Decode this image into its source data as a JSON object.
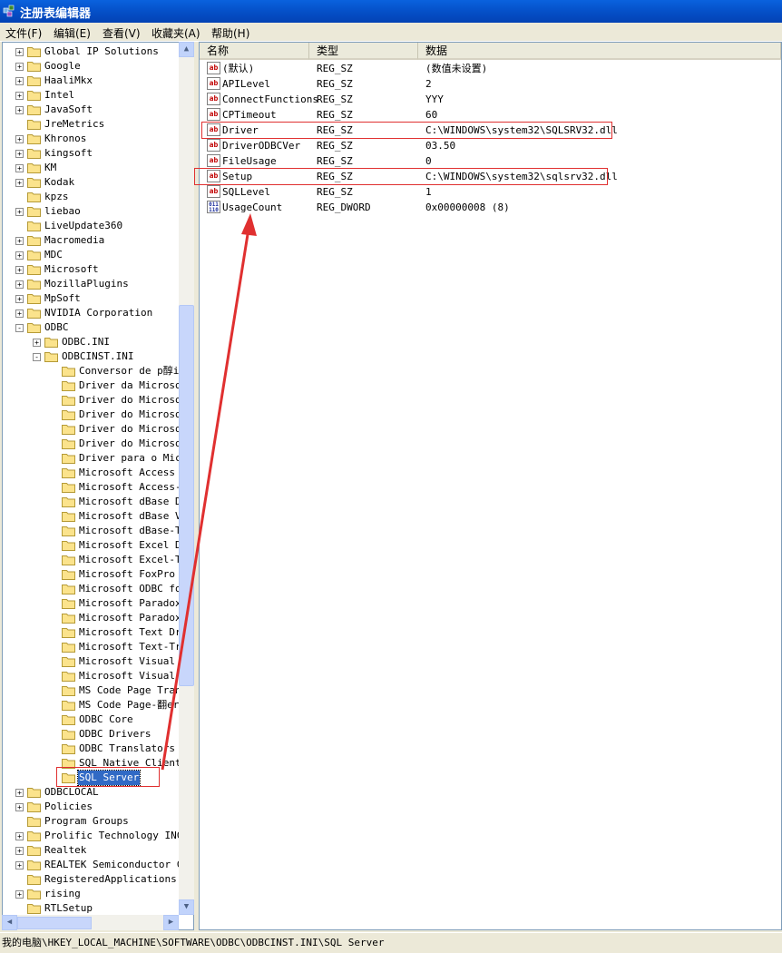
{
  "window": {
    "title": "注册表编辑器"
  },
  "menu": [
    "文件(F)",
    "编辑(E)",
    "查看(V)",
    "收藏夹(A)",
    "帮助(H)"
  ],
  "tree": [
    {
      "label": "Global IP Solutions",
      "level": 0,
      "expander": "+"
    },
    {
      "label": "Google",
      "level": 0,
      "expander": "+"
    },
    {
      "label": "HaaliMkx",
      "level": 0,
      "expander": "+"
    },
    {
      "label": "Intel",
      "level": 0,
      "expander": "+"
    },
    {
      "label": "JavaSoft",
      "level": 0,
      "expander": "+"
    },
    {
      "label": "JreMetrics",
      "level": 0,
      "expander": ""
    },
    {
      "label": "Khronos",
      "level": 0,
      "expander": "+"
    },
    {
      "label": "kingsoft",
      "level": 0,
      "expander": "+"
    },
    {
      "label": "KM",
      "level": 0,
      "expander": "+"
    },
    {
      "label": "Kodak",
      "level": 0,
      "expander": "+"
    },
    {
      "label": "kpzs",
      "level": 0,
      "expander": ""
    },
    {
      "label": "liebao",
      "level": 0,
      "expander": "+"
    },
    {
      "label": "LiveUpdate360",
      "level": 0,
      "expander": ""
    },
    {
      "label": "Macromedia",
      "level": 0,
      "expander": "+"
    },
    {
      "label": "MDC",
      "level": 0,
      "expander": "+"
    },
    {
      "label": "Microsoft",
      "level": 0,
      "expander": "+"
    },
    {
      "label": "MozillaPlugins",
      "level": 0,
      "expander": "+"
    },
    {
      "label": "MpSoft",
      "level": 0,
      "expander": "+"
    },
    {
      "label": "NVIDIA Corporation",
      "level": 0,
      "expander": "+"
    },
    {
      "label": "ODBC",
      "level": 0,
      "expander": "-"
    },
    {
      "label": "ODBC.INI",
      "level": 1,
      "expander": "+"
    },
    {
      "label": "ODBCINST.INI",
      "level": 1,
      "expander": "-"
    },
    {
      "label": "Conversor de p醇ir",
      "level": 2,
      "expander": ""
    },
    {
      "label": "Driver da Microsof",
      "level": 2,
      "expander": ""
    },
    {
      "label": "Driver do Microsof",
      "level": 2,
      "expander": ""
    },
    {
      "label": "Driver do Microsof",
      "level": 2,
      "expander": ""
    },
    {
      "label": "Driver do Microsof",
      "level": 2,
      "expander": ""
    },
    {
      "label": "Driver do Microsof",
      "level": 2,
      "expander": ""
    },
    {
      "label": "Driver para o Micr",
      "level": 2,
      "expander": ""
    },
    {
      "label": "Microsoft Access D",
      "level": 2,
      "expander": ""
    },
    {
      "label": "Microsoft Access-T",
      "level": 2,
      "expander": ""
    },
    {
      "label": "Microsoft dBase Dr",
      "level": 2,
      "expander": ""
    },
    {
      "label": "Microsoft dBase VF",
      "level": 2,
      "expander": ""
    },
    {
      "label": "Microsoft dBase-Tr",
      "level": 2,
      "expander": ""
    },
    {
      "label": "Microsoft Excel Dr",
      "level": 2,
      "expander": ""
    },
    {
      "label": "Microsoft Excel-Tr",
      "level": 2,
      "expander": ""
    },
    {
      "label": "Microsoft FoxPro V",
      "level": 2,
      "expander": ""
    },
    {
      "label": "Microsoft ODBC for",
      "level": 2,
      "expander": ""
    },
    {
      "label": "Microsoft Paradox",
      "level": 2,
      "expander": ""
    },
    {
      "label": "Microsoft Paradox-",
      "level": 2,
      "expander": ""
    },
    {
      "label": "Microsoft Text Dri",
      "level": 2,
      "expander": ""
    },
    {
      "label": "Microsoft Text-Tre",
      "level": 2,
      "expander": ""
    },
    {
      "label": "Microsoft Visual F",
      "level": 2,
      "expander": ""
    },
    {
      "label": "Microsoft Visual F",
      "level": 2,
      "expander": ""
    },
    {
      "label": "MS Code Page Trans",
      "level": 2,
      "expander": ""
    },
    {
      "label": "MS Code Page-翻ers",
      "level": 2,
      "expander": ""
    },
    {
      "label": "ODBC Core",
      "level": 2,
      "expander": ""
    },
    {
      "label": "ODBC Drivers",
      "level": 2,
      "expander": ""
    },
    {
      "label": "ODBC Translators",
      "level": 2,
      "expander": ""
    },
    {
      "label": "SQL Native Client",
      "level": 2,
      "expander": ""
    },
    {
      "label": "SQL Server",
      "level": 2,
      "expander": "",
      "selected": true
    },
    {
      "label": "ODBCLOCAL",
      "level": 0,
      "expander": "+"
    },
    {
      "label": "Policies",
      "level": 0,
      "expander": "+"
    },
    {
      "label": "Program Groups",
      "level": 0,
      "expander": ""
    },
    {
      "label": "Prolific Technology INC",
      "level": 0,
      "expander": "+"
    },
    {
      "label": "Realtek",
      "level": 0,
      "expander": "+"
    },
    {
      "label": "REALTEK Semiconductor Co",
      "level": 0,
      "expander": "+"
    },
    {
      "label": "RegisteredApplications",
      "level": 0,
      "expander": ""
    },
    {
      "label": "rising",
      "level": 0,
      "expander": "+"
    },
    {
      "label": "RTLSetup",
      "level": 0,
      "expander": ""
    }
  ],
  "columns": {
    "name": "名称",
    "type": "类型",
    "data": "数据"
  },
  "values": [
    {
      "name": "(默认)",
      "type": "REG_SZ",
      "data": "(数值未设置)",
      "icon": "ab"
    },
    {
      "name": "APILevel",
      "type": "REG_SZ",
      "data": "2",
      "icon": "ab"
    },
    {
      "name": "ConnectFunctions",
      "type": "REG_SZ",
      "data": "YYY",
      "icon": "ab"
    },
    {
      "name": "CPTimeout",
      "type": "REG_SZ",
      "data": "60",
      "icon": "ab"
    },
    {
      "name": "Driver",
      "type": "REG_SZ",
      "data": "C:\\WINDOWS\\system32\\SQLSRV32.dll",
      "icon": "ab",
      "highlight": true
    },
    {
      "name": "DriverODBCVer",
      "type": "REG_SZ",
      "data": "03.50",
      "icon": "ab"
    },
    {
      "name": "FileUsage",
      "type": "REG_SZ",
      "data": "0",
      "icon": "ab"
    },
    {
      "name": "Setup",
      "type": "REG_SZ",
      "data": "C:\\WINDOWS\\system32\\sqlsrv32.dll",
      "icon": "ab",
      "highlight": true
    },
    {
      "name": "SQLLevel",
      "type": "REG_SZ",
      "data": "1",
      "icon": "ab"
    },
    {
      "name": "UsageCount",
      "type": "REG_DWORD",
      "data": "0x00000008 (8)",
      "icon": "011"
    }
  ],
  "status": "我的电脑\\HKEY_LOCAL_MACHINE\\SOFTWARE\\ODBC\\ODBCINST.INI\\SQL Server",
  "colors": {
    "annotation": "#e03030",
    "selection": "#316ac5",
    "titlebar": "#0550c8"
  }
}
